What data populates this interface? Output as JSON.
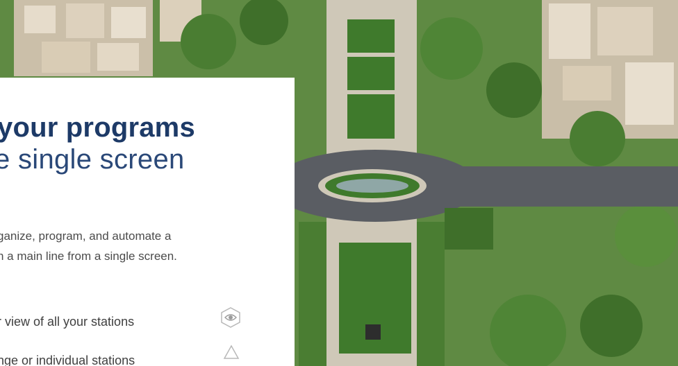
{
  "hero": {
    "heading_strong": "your programs",
    "heading_light": "e single screen",
    "description_line1": "ganize, program, and automate a",
    "description_line2": "n a main line from a single screen."
  },
  "features": [
    {
      "label": "r view of all your stations",
      "icon": "eye-icon"
    },
    {
      "label": "nge or individual stations",
      "icon": "triangle-icon"
    }
  ],
  "colors": {
    "heading": "#1d3a67",
    "text": "#4b4b4b",
    "lawn": "#3f7a2c",
    "trees": "#4a7d32",
    "pavement": "#cfc8b8",
    "road": "#5a5d63",
    "buildings": "#d8cdbb"
  }
}
